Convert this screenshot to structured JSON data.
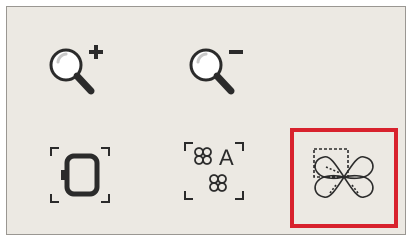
{
  "toolbar": {
    "tools": [
      {
        "name": "zoom-in",
        "icon": "zoom-in-icon",
        "selected": false
      },
      {
        "name": "zoom-out",
        "icon": "zoom-out-icon",
        "selected": false
      },
      {
        "name": "fit-to-hoop",
        "icon": "hoop-frame-icon",
        "selected": false
      },
      {
        "name": "select-all",
        "icon": "select-all-designs-icon",
        "label": "A",
        "selected": false
      },
      {
        "name": "select-by-area",
        "icon": "area-select-design-icon",
        "selected": true
      }
    ],
    "selection_color": "#d8222d"
  }
}
